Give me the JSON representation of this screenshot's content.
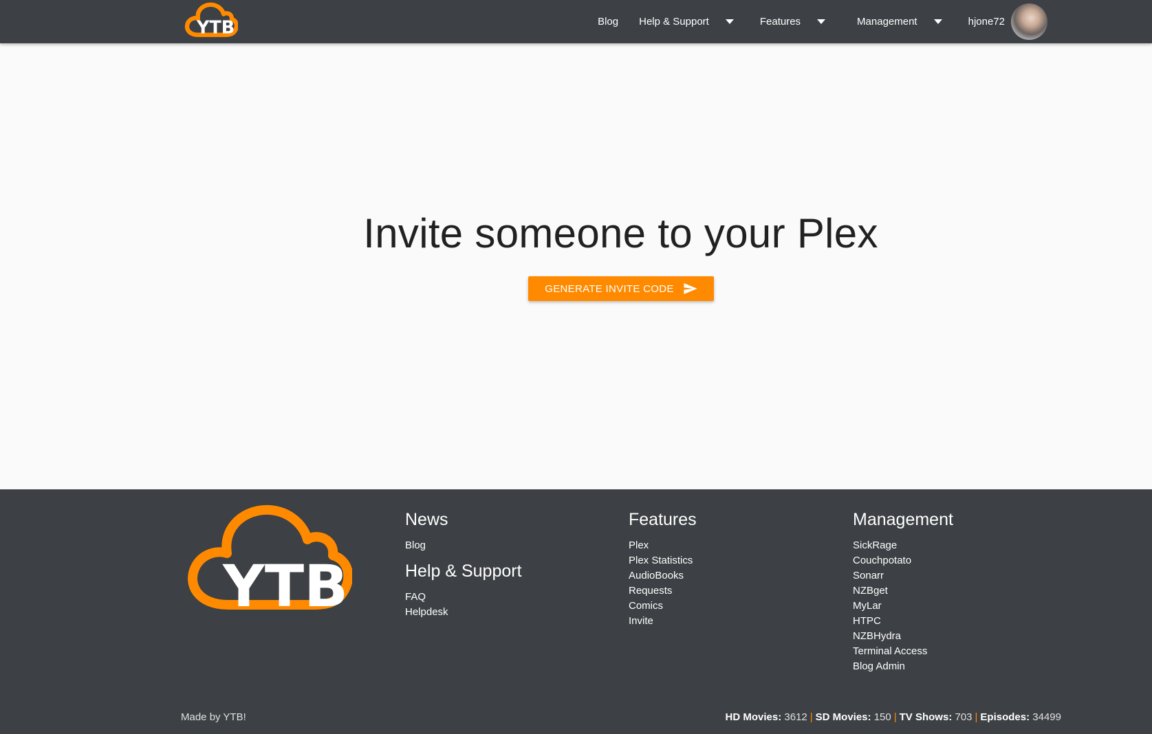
{
  "brand": {
    "logo_text": "YTB",
    "accent": "#ff8a00",
    "bar_bg": "#3d4044"
  },
  "nav": {
    "blog": "Blog",
    "help": "Help & Support",
    "features": "Features",
    "management": "Management",
    "username": "hjone72"
  },
  "main": {
    "title": "Invite someone to your Plex",
    "cta_label": "GENERATE INVITE CODE"
  },
  "footer": {
    "news": {
      "heading": "News",
      "links": [
        "Blog"
      ]
    },
    "help": {
      "heading": "Help & Support",
      "links": [
        "FAQ",
        "Helpdesk"
      ]
    },
    "features": {
      "heading": "Features",
      "links": [
        "Plex",
        "Plex Statistics",
        "AudioBooks",
        "Requests",
        "Comics",
        "Invite"
      ]
    },
    "management": {
      "heading": "Management",
      "links": [
        "SickRage",
        "Couchpotato",
        "Sonarr",
        "NZBget",
        "MyLar",
        "HTPC",
        "NZBHydra",
        "Terminal Access",
        "Blog Admin"
      ]
    },
    "made_by": "Made by YTB!",
    "stats": [
      {
        "label": "HD Movies:",
        "value": "3612"
      },
      {
        "label": "SD Movies:",
        "value": "150"
      },
      {
        "label": "TV Shows:",
        "value": "703"
      },
      {
        "label": "Episodes:",
        "value": "34499"
      }
    ]
  }
}
